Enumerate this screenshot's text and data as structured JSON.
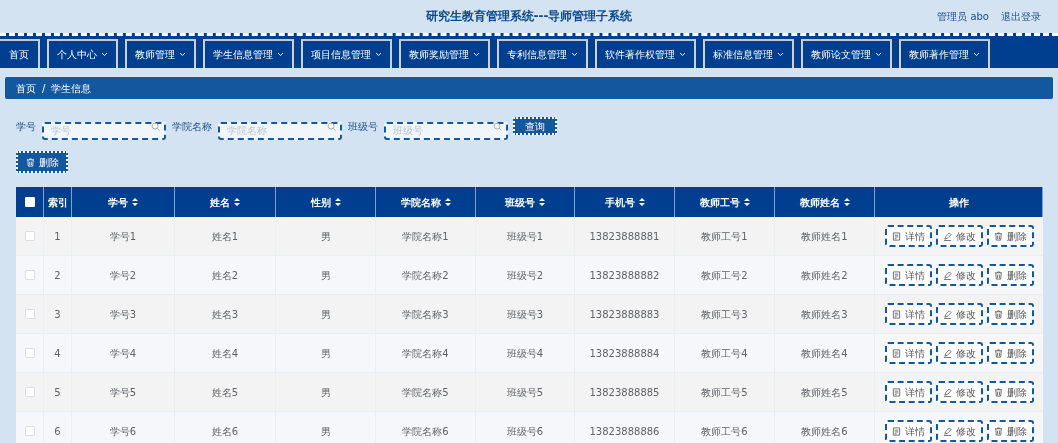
{
  "header": {
    "title": "研究生教育管理系统---导师管理子系统",
    "user": "管理员 abo",
    "logout": "退出登录"
  },
  "nav": [
    {
      "label": "首页",
      "dropdown": false
    },
    {
      "label": "个人中心",
      "dropdown": true
    },
    {
      "label": "教师管理",
      "dropdown": true
    },
    {
      "label": "学生信息管理",
      "dropdown": true
    },
    {
      "label": "项目信息管理",
      "dropdown": true
    },
    {
      "label": "教师奖励管理",
      "dropdown": true
    },
    {
      "label": "专利信息管理",
      "dropdown": true
    },
    {
      "label": "软件著作权管理",
      "dropdown": true
    },
    {
      "label": "标准信息管理",
      "dropdown": true
    },
    {
      "label": "教师论文管理",
      "dropdown": true
    },
    {
      "label": "教师著作管理",
      "dropdown": true
    }
  ],
  "breadcrumb": [
    "首页",
    "/",
    "学生信息"
  ],
  "search": {
    "fields": [
      {
        "label": "学号",
        "placeholder": "学号"
      },
      {
        "label": "学院名称",
        "placeholder": "学院名称"
      },
      {
        "label": "班级号",
        "placeholder": "班级号"
      }
    ],
    "button": "查询"
  },
  "delete_button": "删除",
  "table": {
    "select_all": {
      "checked": false
    },
    "columns": [
      {
        "label": "索引",
        "sortable": false
      },
      {
        "label": "学号",
        "sortable": true
      },
      {
        "label": "姓名",
        "sortable": true
      },
      {
        "label": "性别",
        "sortable": true
      },
      {
        "label": "学院名称",
        "sortable": true
      },
      {
        "label": "班级号",
        "sortable": true
      },
      {
        "label": "手机号",
        "sortable": true
      },
      {
        "label": "教师工号",
        "sortable": true
      },
      {
        "label": "教师姓名",
        "sortable": true
      },
      {
        "label": "操作",
        "sortable": false
      }
    ],
    "rows": [
      {
        "checked": false,
        "cells": [
          "1",
          "学号1",
          "姓名1",
          "男",
          "学院名称1",
          "班级号1",
          "13823888881",
          "教师工号1",
          "教师姓名1"
        ],
        "actions": [
          "详情",
          "修改",
          "删除"
        ]
      },
      {
        "checked": false,
        "cells": [
          "2",
          "学号2",
          "姓名2",
          "男",
          "学院名称2",
          "班级号2",
          "13823888882",
          "教师工号2",
          "教师姓名2"
        ],
        "actions": [
          "详情",
          "修改",
          "删除"
        ]
      },
      {
        "checked": false,
        "cells": [
          "3",
          "学号3",
          "姓名3",
          "男",
          "学院名称3",
          "班级号3",
          "13823888883",
          "教师工号3",
          "教师姓名3"
        ],
        "actions": [
          "详情",
          "修改",
          "删除"
        ]
      },
      {
        "checked": false,
        "cells": [
          "4",
          "学号4",
          "姓名4",
          "男",
          "学院名称4",
          "班级号4",
          "13823888884",
          "教师工号4",
          "教师姓名4"
        ],
        "actions": [
          "详情",
          "修改",
          "删除"
        ]
      },
      {
        "checked": false,
        "cells": [
          "5",
          "学号5",
          "姓名5",
          "男",
          "学院名称5",
          "班级号5",
          "13823888885",
          "教师工号5",
          "教师姓名5"
        ],
        "actions": [
          "详情",
          "修改",
          "删除"
        ]
      },
      {
        "checked": false,
        "cells": [
          "6",
          "学号6",
          "姓名6",
          "男",
          "学院名称6",
          "班级号6",
          "13823888886",
          "教师工号6",
          "教师姓名6"
        ],
        "actions": [
          "详情",
          "修改",
          "删除"
        ]
      }
    ]
  }
}
